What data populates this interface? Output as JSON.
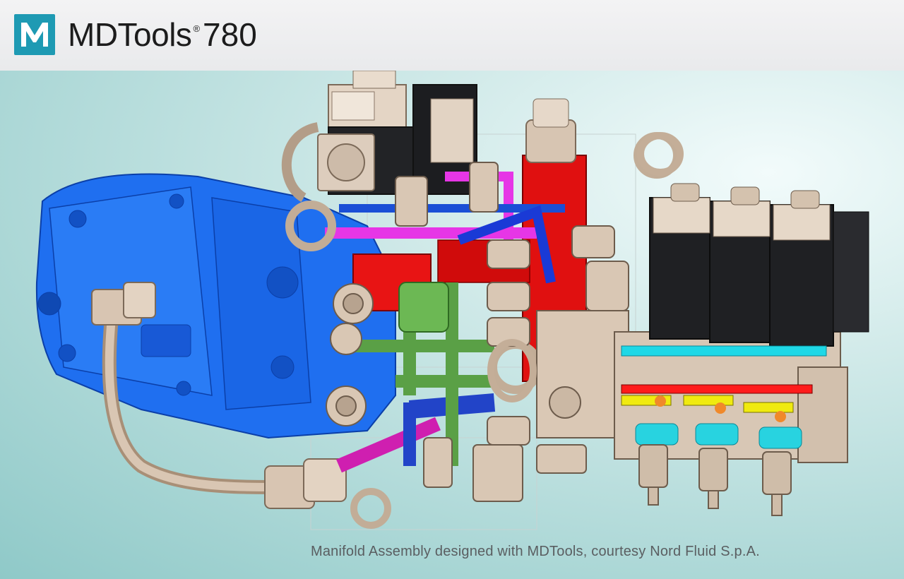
{
  "header": {
    "brand_name": "MDTools",
    "brand_reg": "®",
    "version": "780",
    "logo_letter": "M",
    "accent_color": "#1e9ab3"
  },
  "hero": {
    "caption": "Manifold Assembly designed with MDTools, courtesy Nord Fluid S.p.A.",
    "icon": "manifold-assembly-render"
  }
}
